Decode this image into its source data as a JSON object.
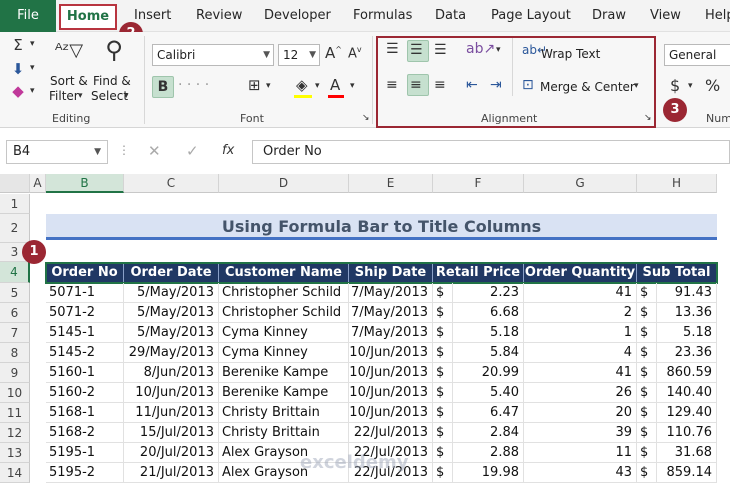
{
  "tabs": [
    "File",
    "Home",
    "Insert",
    "Review",
    "Developer",
    "Formulas",
    "Data",
    "Page Layout",
    "Draw",
    "View",
    "Help"
  ],
  "ribbon": {
    "editing": {
      "sort_filter_1": "Sort &",
      "sort_filter_2": "Filter",
      "find_select_1": "Find &",
      "find_select_2": "Select",
      "label": "Editing"
    },
    "font": {
      "name": "Calibri",
      "size": "12",
      "bold": "B",
      "label": "Font"
    },
    "alignment": {
      "wrap_text": "Wrap Text",
      "merge_center": "Merge & Center",
      "label": "Alignment"
    },
    "number": {
      "format": "General",
      "currency": "$",
      "percent": "%",
      "label": "Num"
    }
  },
  "callouts": [
    "1",
    "2",
    "3"
  ],
  "formula_bar": {
    "name_box": "B4",
    "fx": "fx",
    "value": "Order No"
  },
  "columns": [
    "A",
    "B",
    "C",
    "D",
    "E",
    "F",
    "G",
    "H"
  ],
  "rows": [
    "1",
    "2",
    "3",
    "4",
    "5",
    "6",
    "7",
    "8",
    "9",
    "10",
    "11",
    "12",
    "13",
    "14"
  ],
  "sheet": {
    "title": "Using Formula Bar to Title Columns",
    "headers": [
      "Order No",
      "Order Date",
      "Customer Name",
      "Ship Date",
      "Retail Price",
      "Order Quantity",
      "Sub Total"
    ],
    "data": [
      [
        "5071-1",
        "5/May/2013",
        "Christopher Schild",
        "7/May/2013",
        "$",
        "2.23",
        "41",
        "$",
        "91.43"
      ],
      [
        "5071-2",
        "5/May/2013",
        "Christopher Schild",
        "7/May/2013",
        "$",
        "6.68",
        "2",
        "$",
        "13.36"
      ],
      [
        "5145-1",
        "5/May/2013",
        "Cyma Kinney",
        "7/May/2013",
        "$",
        "5.18",
        "1",
        "$",
        "5.18"
      ],
      [
        "5145-2",
        "29/May/2013",
        "Cyma Kinney",
        "10/Jun/2013",
        "$",
        "5.84",
        "4",
        "$",
        "23.36"
      ],
      [
        "5160-1",
        "8/Jun/2013",
        "Berenike Kampe",
        "10/Jun/2013",
        "$",
        "20.99",
        "41",
        "$",
        "860.59"
      ],
      [
        "5160-2",
        "10/Jun/2013",
        "Berenike Kampe",
        "10/Jun/2013",
        "$",
        "5.40",
        "26",
        "$",
        "140.40"
      ],
      [
        "5168-1",
        "11/Jun/2013",
        "Christy Brittain",
        "10/Jun/2013",
        "$",
        "6.47",
        "20",
        "$",
        "129.40"
      ],
      [
        "5168-2",
        "15/Jul/2013",
        "Christy Brittain",
        "22/Jul/2013",
        "$",
        "2.84",
        "39",
        "$",
        "110.76"
      ],
      [
        "5195-1",
        "20/Jul/2013",
        "Alex Grayson",
        "22/Jul/2013",
        "$",
        "2.88",
        "11",
        "$",
        "31.68"
      ],
      [
        "5195-2",
        "21/Jul/2013",
        "Alex Grayson",
        "22/Jul/2013",
        "$",
        "19.98",
        "43",
        "$",
        "859.14"
      ]
    ]
  },
  "watermark": "exceldemy"
}
